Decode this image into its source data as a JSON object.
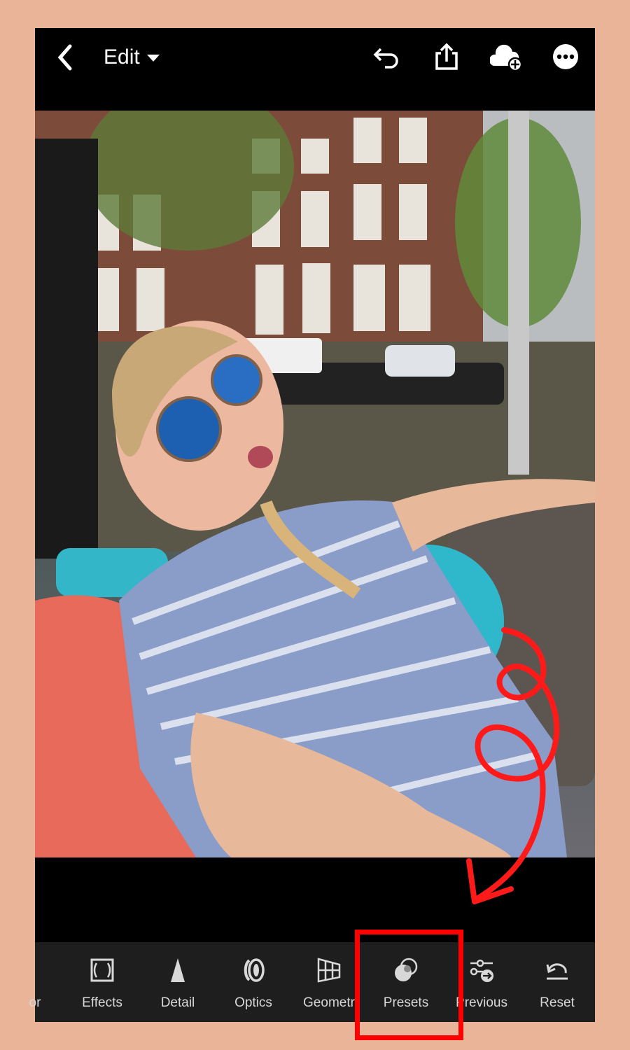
{
  "header": {
    "title": "Edit",
    "icons": [
      "chevron-left-icon",
      "undo-icon",
      "share-icon",
      "cloud-add-icon",
      "more-icon"
    ]
  },
  "toolbar": {
    "items": [
      {
        "label": "or",
        "icon": "color-icon"
      },
      {
        "label": "Effects",
        "icon": "effects-icon"
      },
      {
        "label": "Detail",
        "icon": "detail-icon"
      },
      {
        "label": "Optics",
        "icon": "optics-icon"
      },
      {
        "label": "Geometr",
        "icon": "geometry-icon"
      },
      {
        "label": "Presets",
        "icon": "presets-icon"
      },
      {
        "label": "Previous",
        "icon": "previous-icon"
      },
      {
        "label": "Reset",
        "icon": "reset-icon"
      }
    ]
  },
  "colors": {
    "background": "#e9b497",
    "annotation": "#ff0000",
    "toolbar": "#1e1e1e"
  }
}
